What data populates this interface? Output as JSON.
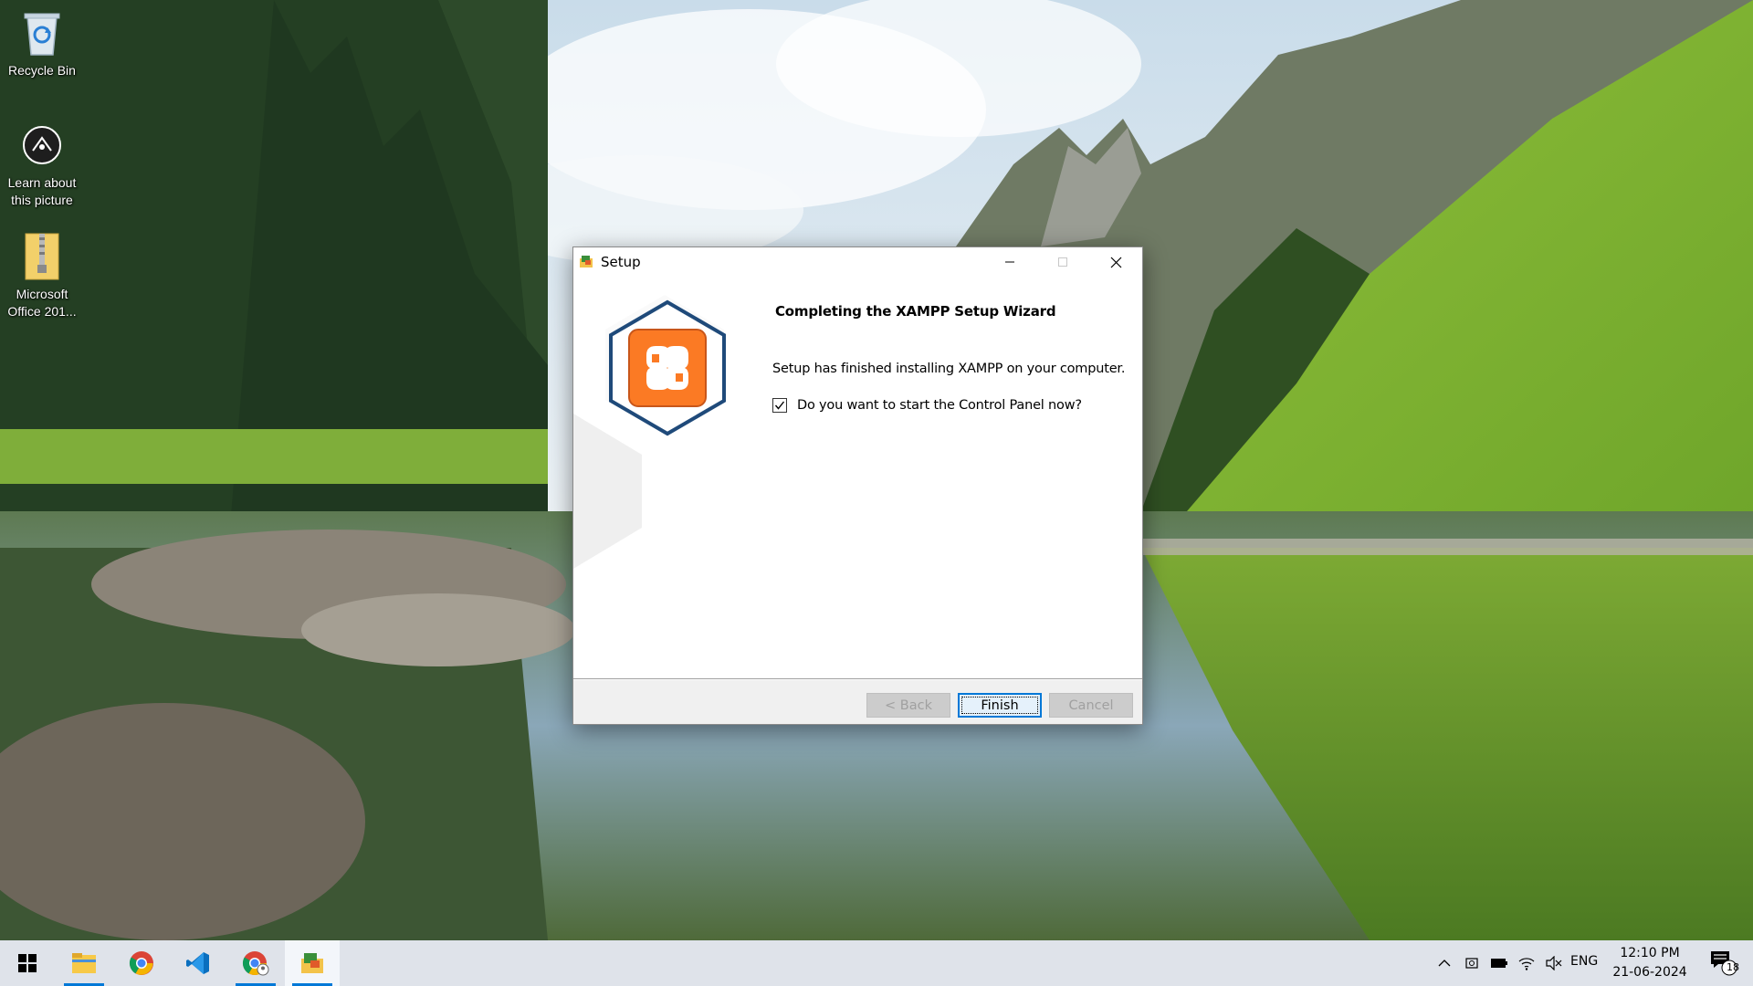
{
  "desktop": {
    "icons": [
      {
        "label": "Recycle Bin",
        "icon": "recycle-bin-icon"
      },
      {
        "label": "Learn about this picture",
        "icon": "learn-about-picture-icon"
      },
      {
        "label": "Microsoft Office 201...",
        "icon": "zip-folder-icon"
      }
    ]
  },
  "window": {
    "title": "Setup",
    "heading": "Completing the XAMPP Setup Wizard",
    "message": "Setup has finished installing XAMPP on your computer.",
    "checkbox_label": "Do you want to start the Control Panel now?",
    "checkbox_checked": true,
    "buttons": {
      "back": "< Back",
      "finish": "Finish",
      "cancel": "Cancel"
    },
    "logo_color": "#fb7a24",
    "logo_ring_color": "#1f4a7a"
  },
  "taskbar": {
    "apps": [
      "start-icon",
      "file-explorer-icon",
      "chrome-icon",
      "vscode-icon",
      "chrome-profile-icon",
      "xampp-setup-icon"
    ],
    "language": "ENG",
    "time": "12:10 PM",
    "date": "21-06-2024",
    "notification_count": "18",
    "accent": "#0078d7"
  }
}
